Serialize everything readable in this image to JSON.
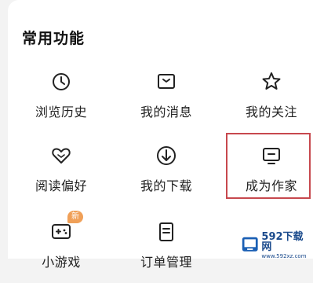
{
  "section": {
    "title": "常用功能"
  },
  "items": [
    {
      "label": "浏览历史",
      "icon": "clock-icon"
    },
    {
      "label": "我的消息",
      "icon": "inbox-icon"
    },
    {
      "label": "我的关注",
      "icon": "star-icon"
    },
    {
      "label": "阅读偏好",
      "icon": "heart-icon"
    },
    {
      "label": "我的下载",
      "icon": "download-icon"
    },
    {
      "label": "成为作家",
      "icon": "monitor-icon"
    },
    {
      "label": "小游戏",
      "icon": "gamepad-icon",
      "badge": "新"
    },
    {
      "label": "订单管理",
      "icon": "document-icon"
    }
  ],
  "watermark": {
    "name": "592下载网",
    "url": "www.592xz.com"
  },
  "colors": {
    "highlight": "#c7484e",
    "badge": "#f0a058",
    "watermark": "#1a4a8c"
  }
}
